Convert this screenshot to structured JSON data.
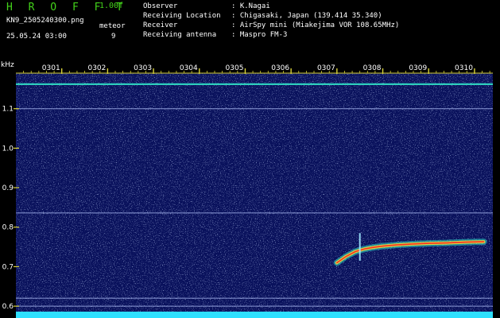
{
  "header": {
    "brand": "H R O F F T",
    "version": "1.00f",
    "filename": "KN9_2505240300.png",
    "timestamp": "25.05.24 03:00",
    "meteor_label": "meteor",
    "meteor_count": "9",
    "info": [
      {
        "key": "Observer",
        "value": ": K.Nagai"
      },
      {
        "key": "Receiving Location",
        "value": ": Chigasaki, Japan (139.414 35.340)"
      },
      {
        "key": "Receiver",
        "value": ": AirSpy mini (Miakejima VOR 108.65MHz)"
      },
      {
        "key": "Receiving antenna",
        "value": ": Maspro FM-3"
      }
    ]
  },
  "colors": {
    "background": "#09115c",
    "text_green": "#43d21a",
    "text_white": "#ffffff",
    "tick_yellow": "#d8d23a",
    "strong_signal": "#ff2a1e",
    "signal_mid": "#f0e63a",
    "signal_low": "#2fd7c2",
    "bottom_bar": "#2ee0ff"
  },
  "chart_data": {
    "type": "heatmap",
    "xlabel": "",
    "ylabel": "kHz",
    "x_ticks": [
      "0301",
      "0302",
      "0303",
      "0304",
      "0305",
      "0306",
      "0307",
      "0308",
      "0309",
      "0310"
    ],
    "xlim": [
      0,
      10.4
    ],
    "y_ticks": [
      "0.6",
      "0.7",
      "0.8",
      "0.9",
      "1.0",
      "1.1"
    ],
    "ylim": [
      0.57,
      1.19
    ],
    "carrier_lines_khz": [
      1.162,
      1.1,
      0.836,
      0.62,
      0.6
    ],
    "meteor_echo": {
      "x": [
        7.0,
        7.2,
        7.4,
        7.6,
        7.8,
        8.0,
        8.3,
        8.6,
        9.0,
        9.4,
        9.8,
        10.2
      ],
      "khz": [
        0.71,
        0.726,
        0.738,
        0.745,
        0.749,
        0.752,
        0.755,
        0.757,
        0.759,
        0.76,
        0.762,
        0.763
      ]
    },
    "meteor_burst": {
      "x": 7.5,
      "khz_min": 0.715,
      "khz_max": 0.785
    },
    "grid": false,
    "legend": "none"
  }
}
